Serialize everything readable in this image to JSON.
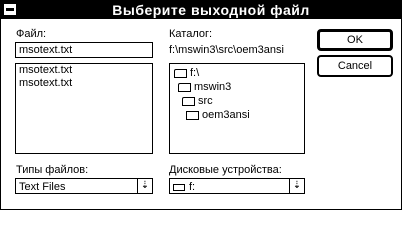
{
  "window": {
    "title": "Выберите выходной файл"
  },
  "file": {
    "label": "Файл:",
    "value": "msotext.txt",
    "list": [
      "msotext.txt",
      "msotext.txt"
    ]
  },
  "directory": {
    "label": "Каталог:",
    "path": "f:\\mswin3\\src\\oem3ansi",
    "tree": [
      "f:\\",
      "mswin3",
      "src",
      "oem3ansi"
    ]
  },
  "buttons": {
    "ok": "OK",
    "cancel": "Cancel"
  },
  "filetypes": {
    "label": "Типы файлов:",
    "value": "Text Files"
  },
  "drives": {
    "label": "Дисковые устройства:",
    "value": "f:"
  }
}
